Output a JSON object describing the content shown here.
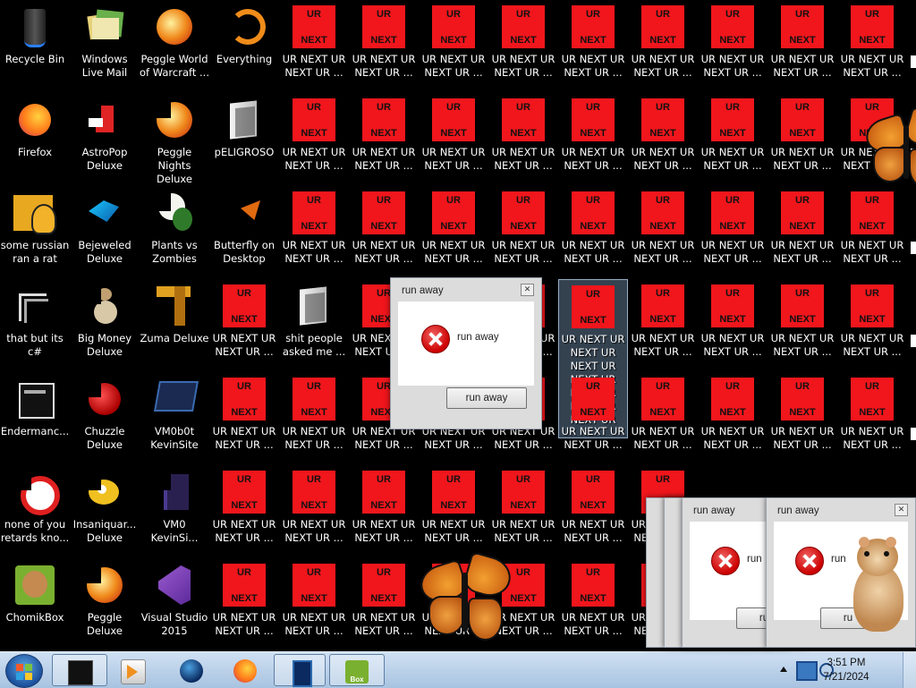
{
  "desktop": {
    "icons": [
      {
        "label": "Recycle Bin",
        "col": 0,
        "row": 0,
        "icon": "recycle-bin-icon",
        "kind": "bin"
      },
      {
        "label": "Windows Live Mail",
        "col": 1,
        "row": 0,
        "icon": "windows-live-mail-icon",
        "kind": "mail"
      },
      {
        "label": "Peggle World of Warcraft ...",
        "col": 2,
        "row": 0,
        "icon": "peggle-icon",
        "kind": "peggle"
      },
      {
        "label": "Everything",
        "col": 3,
        "row": 0,
        "icon": "everything-icon",
        "kind": "everything"
      },
      {
        "label": "Firefox",
        "col": 0,
        "row": 1,
        "icon": "firefox-icon",
        "kind": "firefox"
      },
      {
        "label": "AstroPop Deluxe",
        "col": 1,
        "row": 1,
        "icon": "astropop-icon",
        "kind": "astropop"
      },
      {
        "label": "Peggle Nights Deluxe",
        "col": 2,
        "row": 1,
        "icon": "peggle-nights-icon",
        "kind": "peggle"
      },
      {
        "label": "pELIGROSO",
        "col": 3,
        "row": 1,
        "icon": "document-icon",
        "kind": "doc"
      },
      {
        "label": "some russian ran a rat",
        "col": 0,
        "row": 2,
        "icon": "folder-e-icon",
        "kind": "folder"
      },
      {
        "label": "Bejeweled Deluxe",
        "col": 1,
        "row": 2,
        "icon": "bejeweled-icon",
        "kind": "bejeweled"
      },
      {
        "label": "Plants vs Zombies",
        "col": 2,
        "row": 2,
        "icon": "plants-vs-zombies-icon",
        "kind": "pvz"
      },
      {
        "label": "Butterfly on Desktop",
        "col": 3,
        "row": 2,
        "icon": "butterfly-icon",
        "kind": "butterfly"
      },
      {
        "label": "that but its c#",
        "col": 0,
        "row": 3,
        "icon": "shortcut-icon",
        "kind": "shortcut"
      },
      {
        "label": "Big Money Deluxe",
        "col": 1,
        "row": 3,
        "icon": "big-money-icon",
        "kind": "bigmoney"
      },
      {
        "label": "Zuma Deluxe",
        "col": 2,
        "row": 3,
        "icon": "zuma-icon",
        "kind": "zuma"
      },
      {
        "label": "shit people asked me ...",
        "col": 4,
        "row": 3,
        "icon": "document-icon",
        "kind": "doc"
      },
      {
        "label": "Endermanc...",
        "col": 0,
        "row": 4,
        "icon": "endermanch-icon",
        "kind": "ender"
      },
      {
        "label": "Chuzzle Deluxe",
        "col": 1,
        "row": 4,
        "icon": "chuzzle-icon",
        "kind": "chuzzle"
      },
      {
        "label": "VM0b0t KevinSite",
        "col": 2,
        "row": 4,
        "icon": "vm-icon",
        "kind": "vm"
      },
      {
        "label": "none of you retards kno...",
        "col": 0,
        "row": 5,
        "icon": "red-circle-icon",
        "kind": "redcircle"
      },
      {
        "label": "Insaniquar... Deluxe",
        "col": 1,
        "row": 5,
        "icon": "insaniquarium-icon",
        "kind": "fish"
      },
      {
        "label": "VM0 KevinSi...",
        "col": 2,
        "row": 5,
        "icon": "vm-icon",
        "kind": "vm2"
      },
      {
        "label": "ChomikBox",
        "col": 0,
        "row": 6,
        "icon": "chomikbox-icon",
        "kind": "chomik"
      },
      {
        "label": "Peggle Deluxe",
        "col": 1,
        "row": 6,
        "icon": "peggle-deluxe-icon",
        "kind": "peggle"
      },
      {
        "label": "Visual Studio 2015",
        "col": 2,
        "row": 6,
        "icon": "visual-studio-icon",
        "kind": "vs"
      }
    ],
    "ur_icon": {
      "top": "UR",
      "bottom": "NEXT",
      "label": "UR NEXT UR NEXT UR ...",
      "label_expanded": "UR NEXT UR NEXT UR NEXT UR NEXT UR NEXT UR NEXT UR NEXT UR",
      "color": "#f0161c"
    }
  },
  "dialogs": [
    {
      "title": "run away",
      "message": "run away",
      "button": "run away",
      "close": "✕"
    },
    {
      "title": "run away",
      "message": "run",
      "button": "ru",
      "close": "✕"
    },
    {
      "title": "run away",
      "message": "run",
      "button": "ru",
      "close": "✕"
    }
  ],
  "taskbar": {
    "items": [
      {
        "name": "taskbar-app-black",
        "icon": "black-box-icon"
      },
      {
        "name": "taskbar-media-player",
        "icon": "media-player-icon"
      },
      {
        "name": "taskbar-globe",
        "icon": "globe-icon"
      },
      {
        "name": "taskbar-firefox",
        "icon": "firefox-icon"
      },
      {
        "name": "taskbar-window",
        "icon": "window-icon"
      },
      {
        "name": "taskbar-chomikbox",
        "icon": "chomikbox-icon"
      }
    ],
    "chomik_label": "Box",
    "time": "3:51 PM",
    "date": "7/21/2024"
  }
}
